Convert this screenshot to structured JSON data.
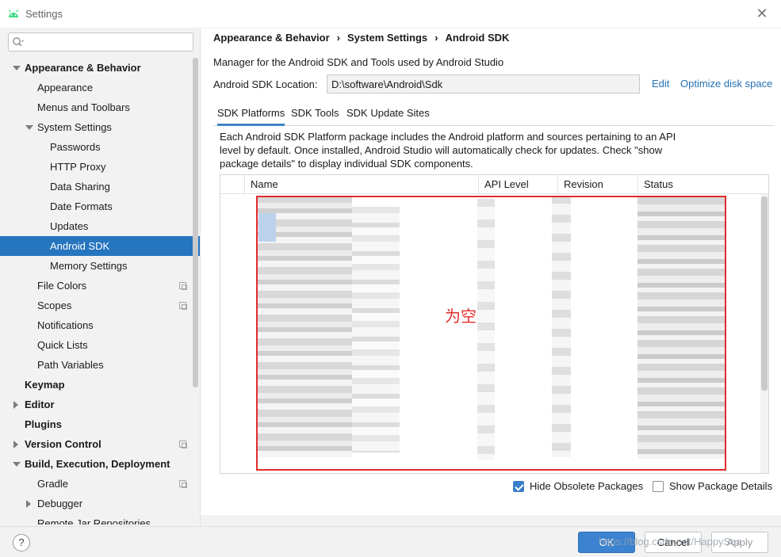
{
  "window": {
    "title": "Settings"
  },
  "search": {
    "placeholder": ""
  },
  "sidebar": {
    "items": [
      {
        "label": "Appearance & Behavior",
        "bold": true,
        "expanded": true
      },
      {
        "label": "Appearance"
      },
      {
        "label": "Menus and Toolbars"
      },
      {
        "label": "System Settings",
        "expanded": true
      },
      {
        "label": "Passwords"
      },
      {
        "label": "HTTP Proxy"
      },
      {
        "label": "Data Sharing"
      },
      {
        "label": "Date Formats"
      },
      {
        "label": "Updates"
      },
      {
        "label": "Android SDK",
        "selected": true
      },
      {
        "label": "Memory Settings"
      },
      {
        "label": "File Colors"
      },
      {
        "label": "Scopes"
      },
      {
        "label": "Notifications"
      },
      {
        "label": "Quick Lists"
      },
      {
        "label": "Path Variables"
      },
      {
        "label": "Keymap",
        "bold": true
      },
      {
        "label": "Editor",
        "bold": true,
        "collapsed": true
      },
      {
        "label": "Plugins",
        "bold": true
      },
      {
        "label": "Version Control",
        "bold": true,
        "collapsed": true
      },
      {
        "label": "Build, Execution, Deployment",
        "bold": true,
        "expanded": true
      },
      {
        "label": "Gradle"
      },
      {
        "label": "Debugger",
        "collapsed": true
      },
      {
        "label": "Remote Jar Repositories"
      }
    ]
  },
  "breadcrumb": [
    "Appearance & Behavior",
    "System Settings",
    "Android SDK"
  ],
  "main": {
    "description": "Manager for the Android SDK and Tools used by Android Studio",
    "sdk_location_label": "Android SDK Location:",
    "sdk_location_value": "D:\\software\\Android\\Sdk",
    "edit_link": "Edit",
    "optimize_link": "Optimize disk space",
    "tabs": [
      "SDK Platforms",
      "SDK Tools",
      "SDK Update Sites"
    ],
    "info_text": "Each Android SDK Platform package includes the Android platform and sources pertaining to an API level by default. Once installed, Android Studio will automatically check for updates. Check \"show package details\" to display individual SDK components.",
    "columns": [
      "Name",
      "API Level",
      "Revision",
      "Status"
    ],
    "annotation": "为空",
    "hide_obsolete": "Hide Obsolete Packages",
    "show_details": "Show Package Details"
  },
  "footer": {
    "help": "?",
    "ok": "OK",
    "cancel": "Cancel",
    "apply": "Apply",
    "watermark": "https://blog.csdn.net/HappySea"
  },
  "colors": {
    "selected": "#2675bf",
    "link": "#2470b3",
    "annotation": "#e32b2b"
  }
}
